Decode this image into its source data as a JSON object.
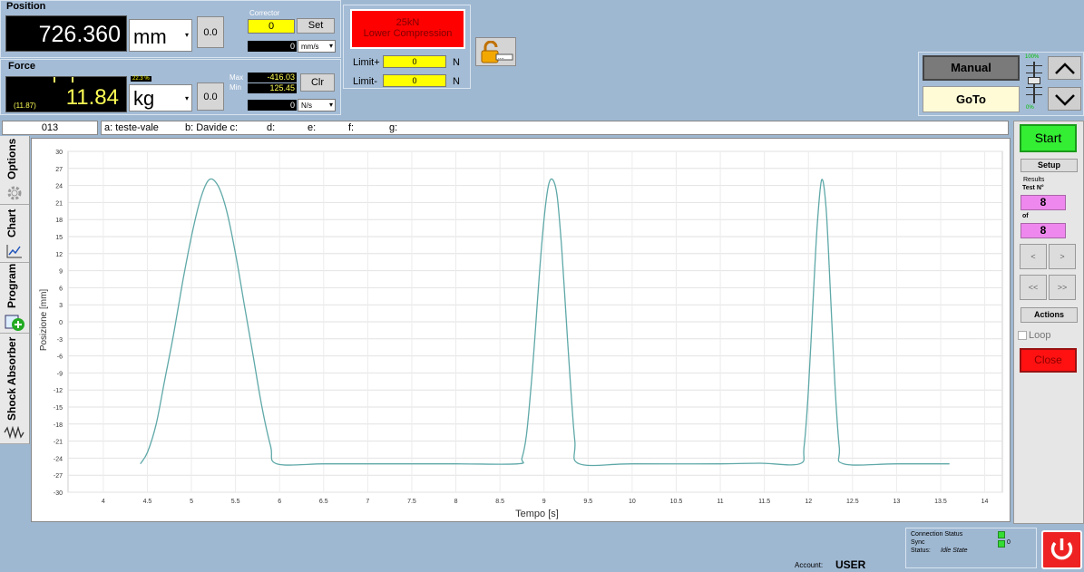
{
  "position": {
    "title": "Position",
    "value": "726.360",
    "unit": "mm",
    "offset": "0.0",
    "corrector_label": "Corrector",
    "corrector_value": "0",
    "set_label": "Set",
    "speed_value": "0",
    "speed_unit": "mm/s"
  },
  "force": {
    "title": "Force",
    "value": "11.84",
    "sub_value": "(11.87)",
    "percent": "22.3 %",
    "unit": "kg",
    "offset": "0.0",
    "max_label": "Max",
    "max_value": "-416.03",
    "min_label": "Min",
    "min_value": "125.45",
    "clr_label": "Clr",
    "rate_value": "0",
    "rate_unit": "N/s"
  },
  "alarm": {
    "line1": "25kN",
    "line2": "Lower Compression"
  },
  "limits": {
    "plus_label": "Limit+",
    "plus_value": "0",
    "plus_unit": "N",
    "minus_label": "Limit-",
    "minus_value": "0",
    "minus_unit": "N"
  },
  "control": {
    "manual_label": "Manual",
    "goto_label": "GoTo",
    "slider_top": "100%",
    "slider_bottom": "0%"
  },
  "info_bar": {
    "id": "013",
    "fields": [
      "a: teste-vale",
      "b: Davide  c:",
      "d:",
      "e:",
      "f:",
      "g:"
    ]
  },
  "left_tabs": [
    "Options",
    "Chart",
    "Program",
    "Shock Absorber"
  ],
  "right_panel": {
    "start_label": "Start",
    "setup_label": "Setup",
    "results_label": "Results",
    "test_n_label": "Test N°",
    "test_n": "8",
    "of_label": "of",
    "of_value": "8",
    "prev_label": "<",
    "next_label": ">",
    "first_label": "<<",
    "last_label": ">>",
    "actions_label": "Actions",
    "loop_label": "Loop",
    "close_label": "Close"
  },
  "chart_data": {
    "type": "line",
    "xlabel": "Tempo [s]",
    "ylabel": "Posizione [mm]",
    "xlim": [
      3.6,
      14.2
    ],
    "ylim": [
      -30,
      30
    ],
    "xticks": [
      "4",
      "4.5",
      "5",
      "5.5",
      "6",
      "6.5",
      "7",
      "7.5",
      "8",
      "8.5",
      "9",
      "9.5",
      "10",
      "10.5",
      "11",
      "11.5",
      "12",
      "12.5",
      "13",
      "13.5",
      "14"
    ],
    "yticks": [
      "30",
      "27",
      "24",
      "21",
      "18",
      "15",
      "12",
      "9",
      "6",
      "3",
      "0",
      "-3",
      "-6",
      "-9",
      "-12",
      "-15",
      "-18",
      "-21",
      "-24",
      "-27",
      "-30"
    ],
    "grid": true,
    "line_color": "#5fa8a8",
    "series": [
      {
        "x": [
          4.42,
          4.5,
          4.6,
          4.7,
          4.8,
          4.9,
          5.0,
          5.1,
          5.2,
          5.3,
          5.4,
          5.5,
          5.6,
          5.7,
          5.8,
          5.9,
          5.97,
          6.5,
          7.0,
          8.0,
          8.7,
          8.75,
          8.8,
          8.85,
          8.9,
          8.95,
          9.0,
          9.05,
          9.1,
          9.15,
          9.2,
          9.25,
          9.3,
          9.35,
          9.4,
          10.0,
          11.0,
          11.45,
          11.9,
          11.95,
          12.0,
          12.05,
          12.1,
          12.15,
          12.2,
          12.25,
          12.3,
          12.35,
          12.4,
          13.0,
          13.6
        ],
        "y": [
          -25,
          -23,
          -18,
          -10,
          -2,
          7,
          15,
          21.5,
          25,
          24,
          19.5,
          12,
          3,
          -6,
          -15,
          -22,
          -25,
          -25,
          -25,
          -25,
          -25,
          -24,
          -20,
          -12,
          -2,
          9,
          18,
          24,
          25,
          22,
          13,
          1,
          -11,
          -21,
          -25,
          -25,
          -25,
          -24.9,
          -25,
          -22,
          -12,
          3,
          17,
          25,
          20,
          5,
          -11,
          -22,
          -25,
          -25,
          -25
        ]
      }
    ]
  },
  "status": {
    "connection_label": "Connection Status",
    "sync_label": "Sync",
    "sync_value": "0",
    "status_label": "Status:",
    "status_value": "Idle State",
    "account_label": "Account:",
    "account_value": "USER"
  }
}
